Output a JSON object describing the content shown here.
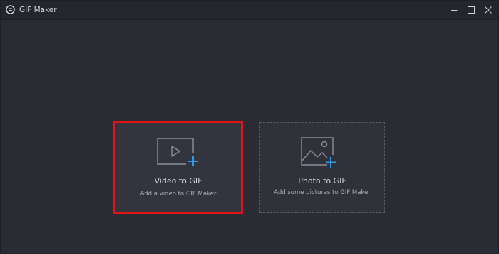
{
  "window": {
    "title": "GIF Maker",
    "logo_icon": "gif-maker-logo-icon",
    "controls": [
      "minimize-icon",
      "maximize-icon",
      "close-icon"
    ]
  },
  "cards": {
    "video": {
      "title": "Video to GIF",
      "subtitle": "Add a video to GIF Maker",
      "icon": "video-add-icon",
      "highlight_color": "#e41414"
    },
    "photo": {
      "title": "Photo to GIF",
      "subtitle": "Add some pictures to GIF Maker",
      "icon": "image-add-icon"
    }
  },
  "colors": {
    "background": "#2b2c33",
    "accent_plus": "#2f9be8"
  }
}
